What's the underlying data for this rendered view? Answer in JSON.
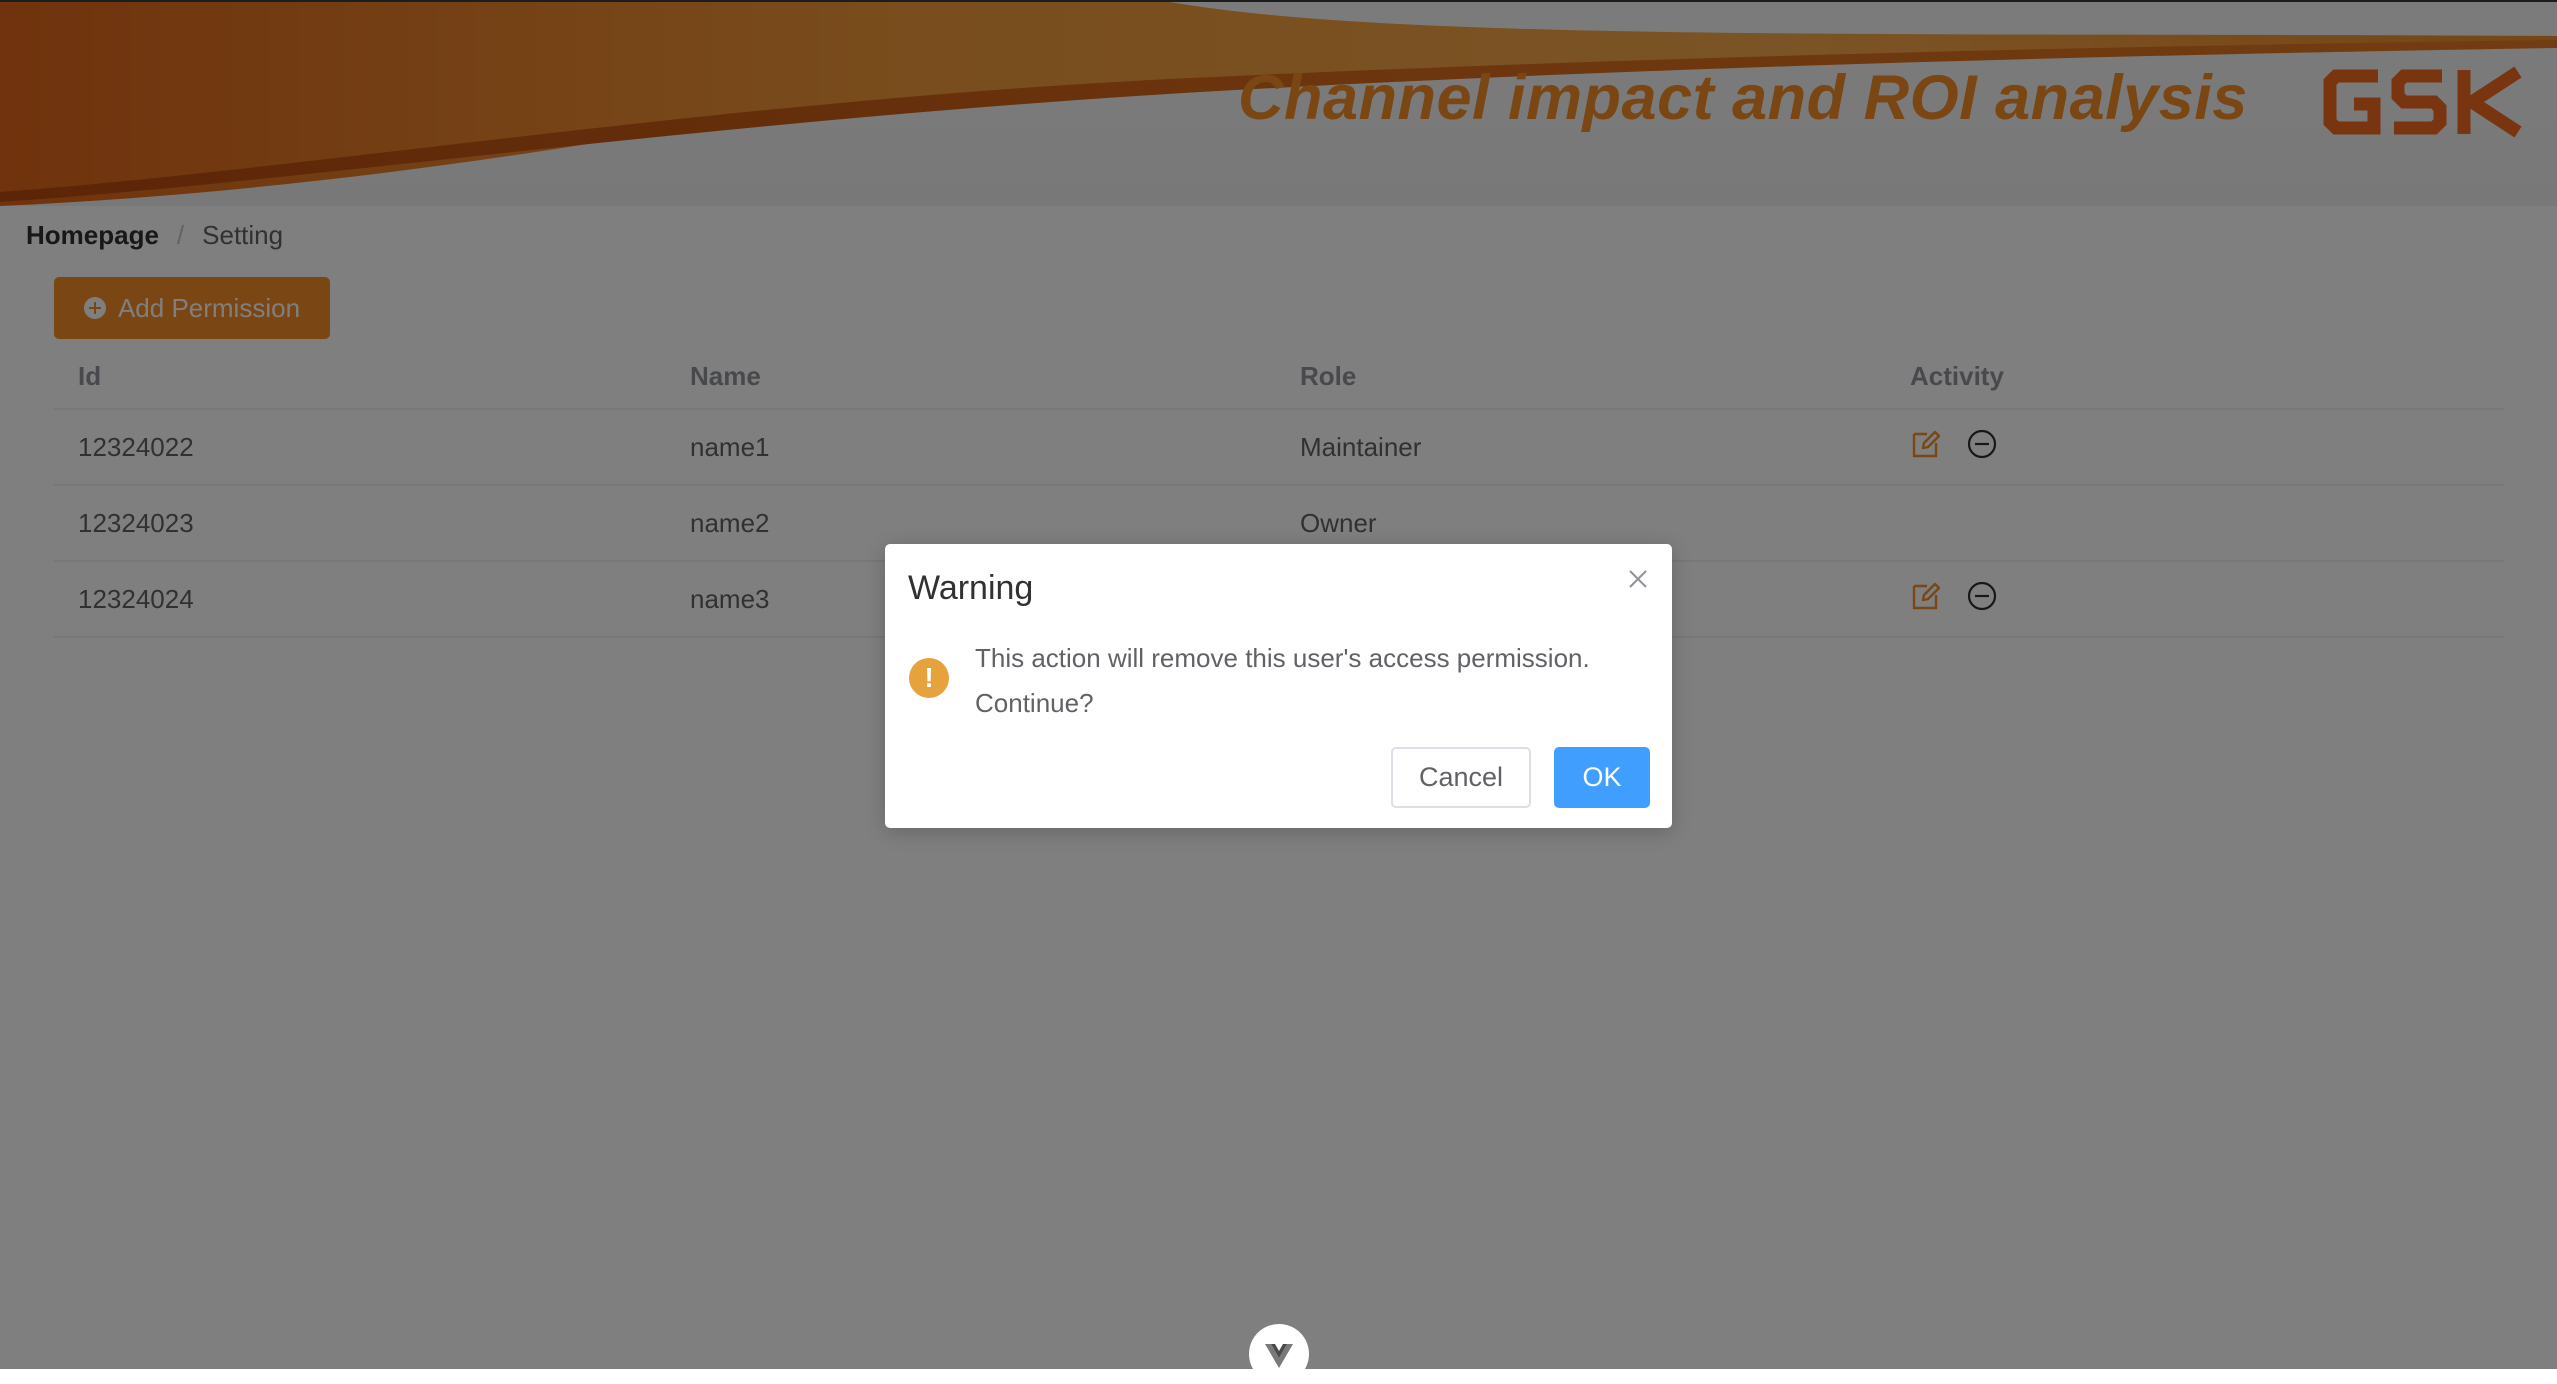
{
  "header": {
    "title": "Channel impact and ROI analysis",
    "logo_text": "GSK",
    "brand_color": "#f28c28"
  },
  "breadcrumb": {
    "home": "Homepage",
    "separator": "/",
    "current": "Setting"
  },
  "toolbar": {
    "add_label": "Add Permission",
    "add_icon": "plus-circle-icon"
  },
  "table": {
    "columns": [
      "Id",
      "Name",
      "Role",
      "Activity"
    ],
    "rows": [
      {
        "id": "12324022",
        "name": "name1",
        "role": "Maintainer",
        "actions": [
          "edit-icon",
          "remove-icon"
        ]
      },
      {
        "id": "12324023",
        "name": "name2",
        "role": "Owner",
        "actions": []
      },
      {
        "id": "12324024",
        "name": "name3",
        "role": "",
        "actions": [
          "edit-icon",
          "remove-icon"
        ]
      }
    ]
  },
  "dialog": {
    "title": "Warning",
    "message_line1": "This action will remove this user's access permission.",
    "message_line2": "Continue?",
    "cancel_label": "Cancel",
    "ok_label": "OK",
    "warning_icon_glyph": "!",
    "ok_color": "#409eff",
    "warning_color": "#e6a23c"
  },
  "bottom_toggle": {
    "icon": "vue-logo-icon"
  }
}
